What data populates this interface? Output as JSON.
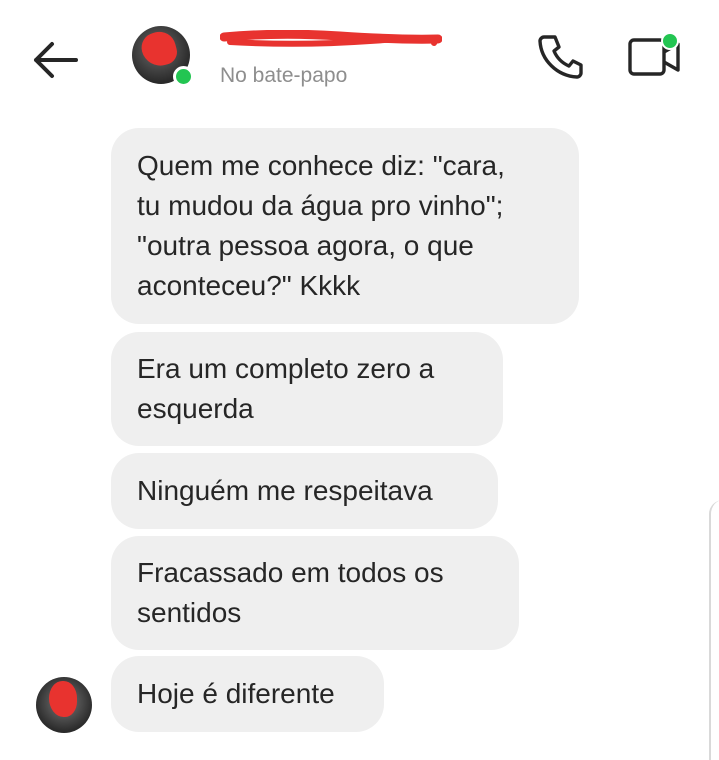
{
  "header": {
    "status": "No bate-papo",
    "icons": [
      "back-arrow-icon",
      "phone-icon",
      "video-camera-icon"
    ],
    "online_color": "#23c552",
    "redaction_color": "#e8332f"
  },
  "messages": [
    {
      "lines": [
        "Quem me conhece diz: \"cara,",
        "tu mudou da água pro vinho\";",
        "\"outra pessoa agora, o que",
        "aconteceu?\" Kkkk"
      ]
    },
    {
      "lines": [
        "Era um completo zero a",
        "esquerda"
      ]
    },
    {
      "lines": [
        "Ninguém me respeitava"
      ]
    },
    {
      "lines": [
        "Fracassado em todos os",
        "sentidos"
      ]
    },
    {
      "lines": [
        "Hoje é diferente"
      ]
    }
  ],
  "bubble_color": "#efefef"
}
